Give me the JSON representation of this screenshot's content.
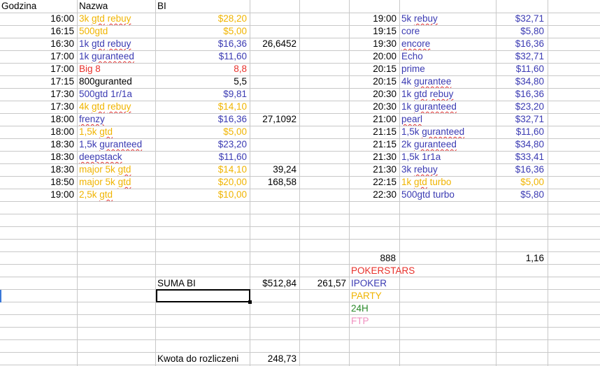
{
  "colors": {
    "blue": "#3a3ab2",
    "gold": "#f0b400",
    "red": "#e8302a",
    "black": "#000000",
    "green": "#2a8a2a",
    "pink": "#f090c0"
  },
  "headers": {
    "godzina": "Godzina",
    "nazwa": "Nazwa",
    "bi": "BI"
  },
  "left_rows": [
    {
      "time": "16:00",
      "name": "3k gtd rebuy",
      "bi": "$28,20",
      "extra": "",
      "color": "gold"
    },
    {
      "time": "16:15",
      "name": "500gtd",
      "bi": "$5,00",
      "extra": "",
      "color": "gold"
    },
    {
      "time": "16:30",
      "name": "1k gtd rebuy",
      "bi": "$16,36",
      "extra": "26,6452",
      "color": "blue"
    },
    {
      "time": "17:00",
      "name": "1k guranteed",
      "bi": "$11,60",
      "extra": "",
      "color": "blue"
    },
    {
      "time": "17:00",
      "name": "Big 8",
      "bi": "8,8",
      "extra": "",
      "color": "red"
    },
    {
      "time": "17:15",
      "name": "800guranted",
      "bi": "5,5",
      "extra": "",
      "color": "black"
    },
    {
      "time": "17:30",
      "name": "500gtd 1r/1a",
      "bi": "$9,81",
      "extra": "",
      "color": "blue"
    },
    {
      "time": "17:30",
      "name": "4k gtd rebuy",
      "bi": "$14,10",
      "extra": "",
      "color": "gold"
    },
    {
      "time": "18:00",
      "name": "frenzy",
      "bi": "$16,36",
      "extra": "27,1092",
      "color": "blue"
    },
    {
      "time": "18:00",
      "name": "1,5k gtd",
      "bi": "$5,00",
      "extra": "",
      "color": "gold"
    },
    {
      "time": "18:30",
      "name": "1,5k guranteed",
      "bi": "$23,20",
      "extra": "",
      "color": "blue"
    },
    {
      "time": "18:30",
      "name": "deepstack",
      "bi": "$11,60",
      "extra": "",
      "color": "blue"
    },
    {
      "time": "18:30",
      "name": "major 5k gtd",
      "bi": "$14,10",
      "extra": "39,24",
      "color": "gold"
    },
    {
      "time": "18:50",
      "name": "major 5k gtd",
      "bi": "$20,00",
      "extra": "168,58",
      "color": "gold"
    },
    {
      "time": "19:00",
      "name": "2,5k gtd",
      "bi": "$10,00",
      "extra": "",
      "color": "gold"
    }
  ],
  "right_rows": [
    {
      "time": "19:00",
      "name": "5k rebuy",
      "bi": "$32,71",
      "color": "blue"
    },
    {
      "time": "19:15",
      "name": "core",
      "bi": "$5,80",
      "color": "blue"
    },
    {
      "time": "19:30",
      "name": "encore",
      "bi": "$16,36",
      "color": "blue"
    },
    {
      "time": "20:00",
      "name": "Echo",
      "bi": "$32,71",
      "color": "blue"
    },
    {
      "time": "20:15",
      "name": "prime",
      "bi": "$11,60",
      "color": "blue"
    },
    {
      "time": "20:15",
      "name": "4k gurantee",
      "bi": "$34,80",
      "color": "blue"
    },
    {
      "time": "20:30",
      "name": "1k gtd rebuy",
      "bi": "$16,36",
      "color": "blue"
    },
    {
      "time": "20:30",
      "name": "1k guranteed",
      "bi": "$23,20",
      "color": "blue"
    },
    {
      "time": "21:00",
      "name": "pearl",
      "bi": "$32,71",
      "color": "blue"
    },
    {
      "time": "21:15",
      "name": "1,5k guranteed",
      "bi": "$11,60",
      "color": "blue"
    },
    {
      "time": "21:15",
      "name": "2k guranteed",
      "bi": "$34,80",
      "color": "blue"
    },
    {
      "time": "21:30",
      "name": "1,5k 1r1a",
      "bi": "$33,41",
      "color": "blue"
    },
    {
      "time": "21:30",
      "name": "3k rebuy",
      "bi": "$16,36",
      "color": "blue"
    },
    {
      "time": "22:15",
      "name": "1k gtd turbo",
      "bi": "$5,00",
      "color": "gold"
    },
    {
      "time": "22:30",
      "name": "500gtd turbo",
      "bi": "$5,80",
      "color": "blue"
    }
  ],
  "summary": {
    "val_888": "888",
    "val_116": "1,16",
    "suma_label": "SUMA BI",
    "suma_value": "$512,84",
    "suma_extra": "261,57",
    "kwota_label": "Kwota do rozliczeni",
    "kwota_value": "248,73"
  },
  "legend": [
    {
      "label": "POKERSTARS",
      "color": "red"
    },
    {
      "label": "IPOKER",
      "color": "blue"
    },
    {
      "label": "PARTY",
      "color": "gold"
    },
    {
      "label": "24H",
      "color": "green"
    },
    {
      "label": "FTP",
      "color": "pink"
    }
  ]
}
